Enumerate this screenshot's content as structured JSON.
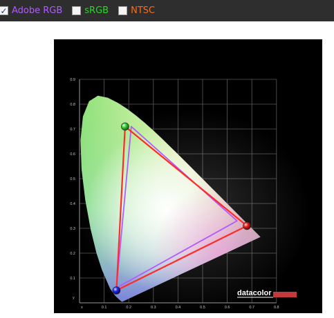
{
  "toolbar": {
    "options": [
      {
        "label": "Adobe RGB",
        "checked": true,
        "color": "#b05cff"
      },
      {
        "label": "sRGB",
        "checked": false,
        "color": "#2bd62b"
      },
      {
        "label": "NTSC",
        "checked": false,
        "color": "#ff6a1a"
      }
    ],
    "check_glyph": "✓"
  },
  "chart_data": {
    "type": "scatter",
    "title": "",
    "xlabel": "x",
    "ylabel": "y",
    "xlim": [
      0,
      0.8
    ],
    "ylim": [
      0,
      0.9
    ],
    "grid": true,
    "x_ticks": [
      "0.1",
      "0.2",
      "0.3",
      "0.4",
      "0.5",
      "0.6",
      "0.7",
      "0.8"
    ],
    "y_ticks": [
      "0.1",
      "0.2",
      "0.3",
      "0.4",
      "0.5",
      "0.6",
      "0.7",
      "0.8",
      "0.9"
    ],
    "gamut_area": "CIE 1931 chromaticity horseshoe",
    "series": [
      {
        "key": "measured",
        "color": "#ff2a2a",
        "points": [
          {
            "x": 0.68,
            "y": 0.31
          },
          {
            "x": 0.185,
            "y": 0.71
          },
          {
            "x": 0.15,
            "y": 0.05
          }
        ]
      },
      {
        "key": "adobe_rgb",
        "color": "#b05cff",
        "points": [
          {
            "x": 0.64,
            "y": 0.33
          },
          {
            "x": 0.21,
            "y": 0.71
          },
          {
            "x": 0.15,
            "y": 0.06
          }
        ]
      }
    ],
    "logo": "datacolor"
  }
}
